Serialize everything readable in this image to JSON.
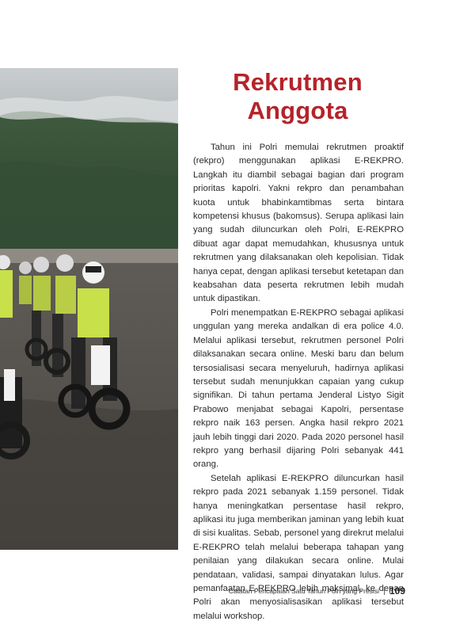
{
  "title": {
    "line1": "Rekrutmen",
    "line2": "Anggota"
  },
  "paragraphs": [
    "Tahun ini Polri memulai rekrutmen proaktif (rekpro) menggunakan aplikasi E-REKPRO. Langkah itu diambil sebagai bagian dari program prioritas kapolri. Yakni rekpro dan penambahan kuota untuk bhabinkamtibmas serta bintara kompetensi khusus (bakomsus). Serupa aplikasi lain yang sudah diluncurkan oleh Polri, E-REKPRO dibuat agar dapat memudahkan, khususnya untuk rekrutmen yang dilaksanakan oleh kepolisian. Tidak hanya cepat, dengan aplikasi tersebut ketetapan dan keabsahan data peserta rekrutmen lebih mudah untuk dipastikan.",
    "Polri menempatkan E-REKPRO sebagai aplikasi unggulan yang mereka andalkan di era police 4.0. Melalui aplikasi tersebut, rekrutmen personel Polri dilaksanakan secara online. Meski baru dan belum tersosialisasi secara menyeluruh, hadirnya aplikasi tersebut sudah menunjukkan capaian yang cukup signifikan. Di tahun pertama Jenderal Listyo Sigit Prabowo menjabat sebagai Kapolri, persentase rekpro naik 163 persen. Angka hasil rekpro 2021 jauh lebih tinggi dari 2020. Pada 2020 personel hasil rekpro yang berhasil dijaring Polri sebanyak 441 orang.",
    "Setelah aplikasi E-REKPRO diluncurkan hasil rekpro pada 2021 sebanyak 1.159 personel. Tidak hanya meningkatkan persentase hasil rekpro, aplikasi itu juga memberikan jaminan yang lebih kuat di sisi kualitas. Sebab, personel yang direkrut melalui E-REKPRO telah melalui beberapa tahapan yang penilaian yang dilakukan secara online. Mulai pendataan, validasi, sampai dinyatakan lulus. Agar pemanfaatan E-REKPRO lebih maksimal, ke depan Polri akan menyosialisasikan aplikasi tersebut melalui workshop."
  ],
  "footer": {
    "caption": "Catatan Pencapaian Satu Tahun Polri yang Presisi",
    "page_number": "109"
  },
  "colors": {
    "title": "#b5232a",
    "vest": "#c8e04a"
  }
}
